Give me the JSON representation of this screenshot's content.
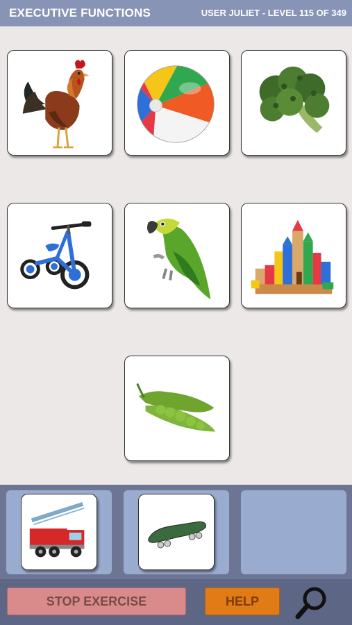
{
  "header": {
    "title": "EXECUTIVE FUNCTIONS",
    "user_level": "USER JULIET - LEVEL 115 OF 349"
  },
  "grid_cards": [
    {
      "icon": "rooster-icon"
    },
    {
      "icon": "beach-ball-icon"
    },
    {
      "icon": "broccoli-icon"
    },
    {
      "icon": "tricycle-icon"
    },
    {
      "icon": "parrot-icon"
    },
    {
      "icon": "toy-blocks-castle-icon"
    },
    {
      "icon": "peas-icon"
    }
  ],
  "tray": {
    "slots": [
      {
        "icon": "fire-truck-icon"
      },
      {
        "icon": "skateboard-icon"
      },
      {
        "icon": null
      }
    ]
  },
  "footer": {
    "stop_label": "STOP EXERCISE",
    "help_label": "HELP",
    "magnifier_icon": "magnifier-icon"
  },
  "colors": {
    "header_bg": "#8894b6",
    "main_bg": "#ede8e8",
    "tray_bg": "#6c7594",
    "slot_bg": "#9aabd0",
    "footer_bg": "#5d6684",
    "stop_button": "#d98b8b",
    "help_button": "#e07b16"
  }
}
